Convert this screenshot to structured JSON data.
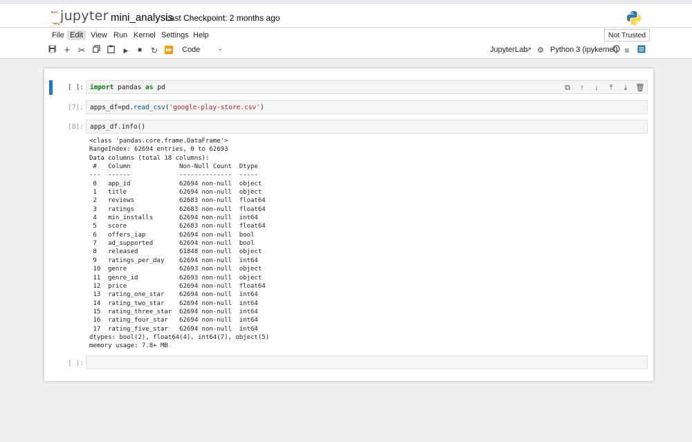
{
  "header": {
    "logo_text": "jupyter",
    "notebook_name": "mini_analysis",
    "checkpoint": "Last Checkpoint: 2 months ago"
  },
  "menu": {
    "items": [
      "File",
      "Edit",
      "View",
      "Run",
      "Kernel",
      "Settings",
      "Help"
    ],
    "active": "Edit",
    "trust_label": "Not Trusted"
  },
  "toolbar": {
    "cell_type": "Code",
    "jupyterlab_label": "JupyterLab",
    "kernel_label": "Python 3 (ipykernel)",
    "icons": [
      "save-icon",
      "add-cell-icon",
      "cut-icon",
      "copy-icon",
      "paste-icon",
      "run-icon",
      "stop-icon",
      "restart-icon",
      "fast-forward-icon"
    ]
  },
  "cells": {
    "c1": {
      "prompt": "[ ]:"
    },
    "c2": {
      "prompt": "[7]:"
    },
    "c3": {
      "prompt": "[8]:",
      "source": "apps_df.info()"
    },
    "c4": {
      "prompt": "[ ]:"
    }
  },
  "output_lines": [
    "<class 'pandas.core.frame.DataFrame'>",
    "RangeIndex: 62694 entries, 0 to 62693",
    "Data columns (total 18 columns):",
    " #   Column             Non-Null Count  Dtype  ",
    "---  ------             --------------  -----  ",
    " 0   app_id             62694 non-null  object ",
    " 1   title              62694 non-null  object ",
    " 2   reviews            62683 non-null  float64",
    " 3   ratings            62683 non-null  float64",
    " 4   min_installs       62694 non-null  int64  ",
    " 5   score              62683 non-null  float64",
    " 6   offers_iap         62694 non-null  bool   ",
    " 7   ad_supported       62694 non-null  bool   ",
    " 8   released           61848 non-null  object ",
    " 9   ratings_per_day    62694 non-null  int64  ",
    " 10  genre              62693 non-null  object ",
    " 11  genre_id           62693 non-null  object ",
    " 12  price              62694 non-null  float64",
    " 13  rating_one_star    62694 non-null  int64  ",
    " 14  rating_two_star    62694 non-null  int64  ",
    " 15  rating_three_star  62694 non-null  int64  ",
    " 16  rating_four_star   62694 non-null  int64  ",
    " 17  rating_five_star   62694 non-null  int64  ",
    "dtypes: bool(2), float64(4), int64(7), object(5)",
    "memory usage: 7.8+ MB"
  ],
  "colors": {
    "selected_bar": "#1976d2",
    "keyword": "#008000",
    "string": "#ba2121",
    "background": "#eeeeee"
  }
}
